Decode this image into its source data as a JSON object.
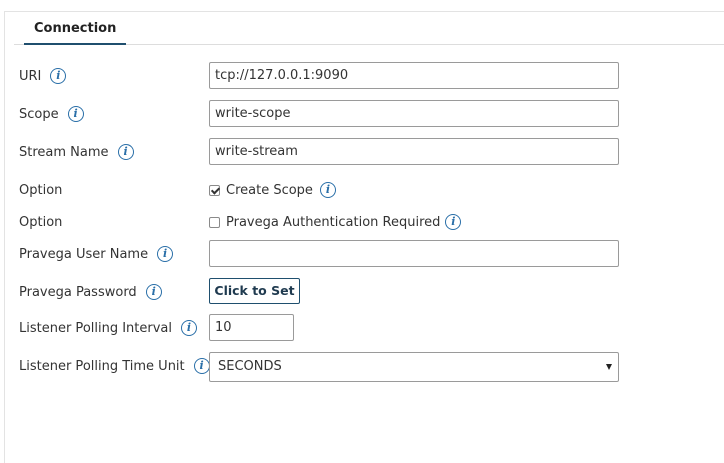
{
  "tabs": [
    {
      "label": "Connection",
      "active": true
    }
  ],
  "fields": {
    "uri": {
      "label": "URI",
      "value": "tcp://127.0.0.1:9090"
    },
    "scope": {
      "label": "Scope",
      "value": "write-scope"
    },
    "stream_name": {
      "label": "Stream Name",
      "value": "write-stream"
    },
    "option_create_scope": {
      "label": "Option",
      "checkbox_label": "Create Scope",
      "checked": true
    },
    "option_auth": {
      "label": "Option",
      "checkbox_label": "Pravega Authentication Required",
      "checked": false
    },
    "user_name": {
      "label": "Pravega User Name",
      "value": ""
    },
    "password": {
      "label": "Pravega Password",
      "button_label": "Click to Set"
    },
    "polling_interval": {
      "label": "Listener Polling Interval",
      "value": "10"
    },
    "polling_time_unit": {
      "label": "Listener Polling Time Unit",
      "selected": "SECONDS"
    }
  },
  "icons": {
    "info": "info-icon",
    "info_glyph": "i",
    "dropdown": "dropdown-arrow-icon"
  },
  "colors": {
    "accent": "#1f4f6e",
    "info": "#2a6fa8",
    "border": "#9a9a9a"
  }
}
